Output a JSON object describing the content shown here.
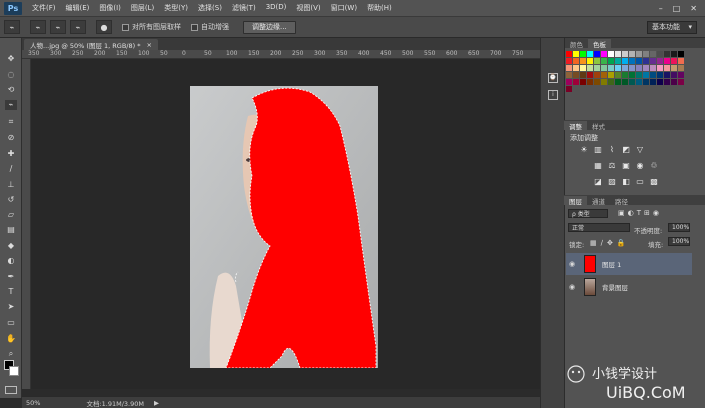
{
  "app": {
    "logo": "Ps"
  },
  "menu": [
    "文件(F)",
    "编辑(E)",
    "图像(I)",
    "图层(L)",
    "类型(Y)",
    "选择(S)",
    "滤镜(T)",
    "3D(D)",
    "视图(V)",
    "窗口(W)",
    "帮助(H)"
  ],
  "window_controls": [
    "–",
    "□",
    "✕"
  ],
  "options": {
    "sample_all_layers": "对所有图层取样",
    "auto_enhance": "自动增强",
    "refine_edge": "调整边缘...",
    "workspace": "基本功能"
  },
  "document": {
    "tab_title": "人物...jpg @ 50% (图层 1, RGB/8) *",
    "close": "×"
  },
  "ruler": {
    "h_ticks": [
      "350",
      "300",
      "250",
      "200",
      "150",
      "100",
      "50",
      "0",
      "50",
      "100",
      "150",
      "200",
      "250",
      "300",
      "350",
      "400",
      "450",
      "500",
      "550",
      "600",
      "650",
      "700",
      "750"
    ]
  },
  "status": {
    "zoom": "50%",
    "doc_size": "文档:1.91M/3.90M"
  },
  "panels": {
    "color_tabs": [
      "颜色",
      "色板"
    ],
    "adjust_tabs": [
      "调整",
      "样式"
    ],
    "adjust_title": "添加调整",
    "layers_tabs": [
      "图层",
      "通道",
      "路径"
    ],
    "layer_kind": "ρ 类型",
    "blend_mode": "正常",
    "opacity_label": "不透明度:",
    "opacity_value": "100%",
    "lock_label": "锁定:",
    "fill_label": "填充:",
    "fill_value": "100%",
    "layers": [
      {
        "name": "图层 1",
        "selected": true
      },
      {
        "name": "背景图层",
        "selected": false
      }
    ]
  },
  "watermark": {
    "line1": "小钱学设计",
    "line2": "UiBQ.CoM"
  },
  "colors": {
    "selection_fill": "#ff0000",
    "panel": "#535353",
    "highlight": "#5a6578"
  }
}
